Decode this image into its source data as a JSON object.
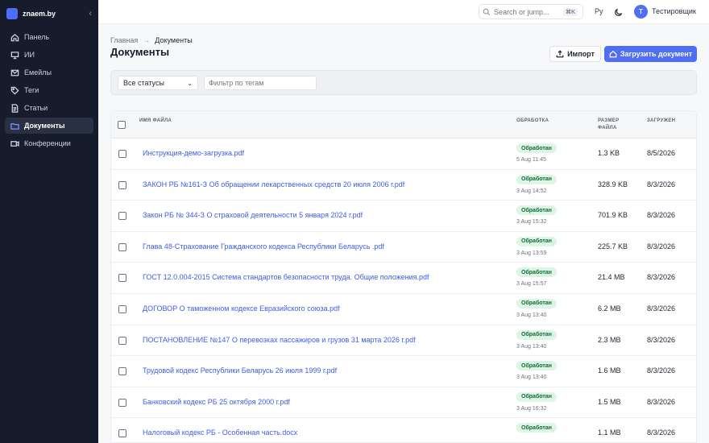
{
  "sidebar": {
    "brand": "znaem.by",
    "collapse_glyph": "‹",
    "items": [
      {
        "label": "Панель",
        "icon": "home-icon"
      },
      {
        "label": "ИИ",
        "icon": "ai-icon"
      },
      {
        "label": "Емейлы",
        "icon": "mail-icon"
      },
      {
        "label": "Теги",
        "icon": "tag-icon"
      },
      {
        "label": "Статьи",
        "icon": "article-icon"
      },
      {
        "label": "Документы",
        "icon": "folder-icon",
        "active": true
      },
      {
        "label": "Конференции",
        "icon": "video-icon"
      }
    ]
  },
  "topbar": {
    "search_placeholder": "Search or jump...",
    "search_shortcut": "⌘K",
    "language": "Ру",
    "avatar_initial": "T",
    "username": "Тестировщик"
  },
  "breadcrumb": {
    "home": "Главная",
    "separator": "→",
    "current": "Документы"
  },
  "page": {
    "title": "Документы",
    "import_label": "Импорт",
    "upload_label": "Загрузить документ"
  },
  "filters": {
    "status_value": "Все статусы",
    "tag_placeholder": "Фильтр по тегам"
  },
  "table": {
    "headers": {
      "name": "ИМЯ ФАЙЛА",
      "processing": "ОБРАБОТКА",
      "size_line1": "РАЗМЕР",
      "size_line2": "ФАЙЛА",
      "uploaded": "ЗАГРУЖЕН"
    },
    "rows": [
      {
        "name": "Инструкция-демо-загрузка.pdf",
        "status": "Обработан",
        "processed_at": "5 Aug 11:45",
        "size": "1.3 KB",
        "uploaded": "8/5/2026"
      },
      {
        "name": "ЗАКОН РБ №161-З Об обращении лекарственных средств 20 июля 2006 г.pdf",
        "status": "Обработан",
        "processed_at": "3 Aug 14:52",
        "size": "328.9 KB",
        "uploaded": "8/3/2026"
      },
      {
        "name": "Закон РБ № 344-З О страховой деятельности 5 января 2024 г.pdf",
        "status": "Обработан",
        "processed_at": "3 Aug 15:32",
        "size": "701.9 KB",
        "uploaded": "8/3/2026"
      },
      {
        "name": "Глава 48-Страхование Гражданского кодекса Республики Беларусь .pdf",
        "status": "Обработан",
        "processed_at": "3 Aug 13:59",
        "size": "225.7 KB",
        "uploaded": "8/3/2026"
      },
      {
        "name": "ГОСТ 12.0.004-2015 Система стандартов безопасности труда. Общие положения.pdf",
        "status": "Обработан",
        "processed_at": "3 Aug 15:57",
        "size": "21.4 MB",
        "uploaded": "8/3/2026"
      },
      {
        "name": "ДОГОВОР О таможенном кодексе Евразийского союза.pdf",
        "status": "Обработан",
        "processed_at": "3 Aug 13:40",
        "size": "6.2 MB",
        "uploaded": "8/3/2026"
      },
      {
        "name": "ПОСТАНОВЛЕНИЕ №147 О перевозках пассажиров и грузов 31 марта 2026 г.pdf",
        "status": "Обработан",
        "processed_at": "3 Aug 13:40",
        "size": "2.3 MB",
        "uploaded": "8/3/2026"
      },
      {
        "name": "Трудовой кодекс Республики Беларусь 26 июля 1999 г.pdf",
        "status": "Обработан",
        "processed_at": "3 Aug 13:40",
        "size": "1.6 MB",
        "uploaded": "8/3/2026"
      },
      {
        "name": "Банковский кодекс РБ 25 октября 2000 г.pdf",
        "status": "Обработан",
        "processed_at": "3 Aug 16:32",
        "size": "1.5 MB",
        "uploaded": "8/3/2026"
      },
      {
        "name": "Налоговый кодекс РБ - Особенная часть.docx",
        "status": "Обработан",
        "processed_at": "",
        "size": "1.1 MB",
        "uploaded": "8/3/2026"
      }
    ]
  },
  "colors": {
    "accent": "#4f6df5",
    "sidebar_bg": "#161c2b",
    "link": "#3d5ce8",
    "badge_bg": "#dcf5e4",
    "badge_text": "#146b37"
  }
}
